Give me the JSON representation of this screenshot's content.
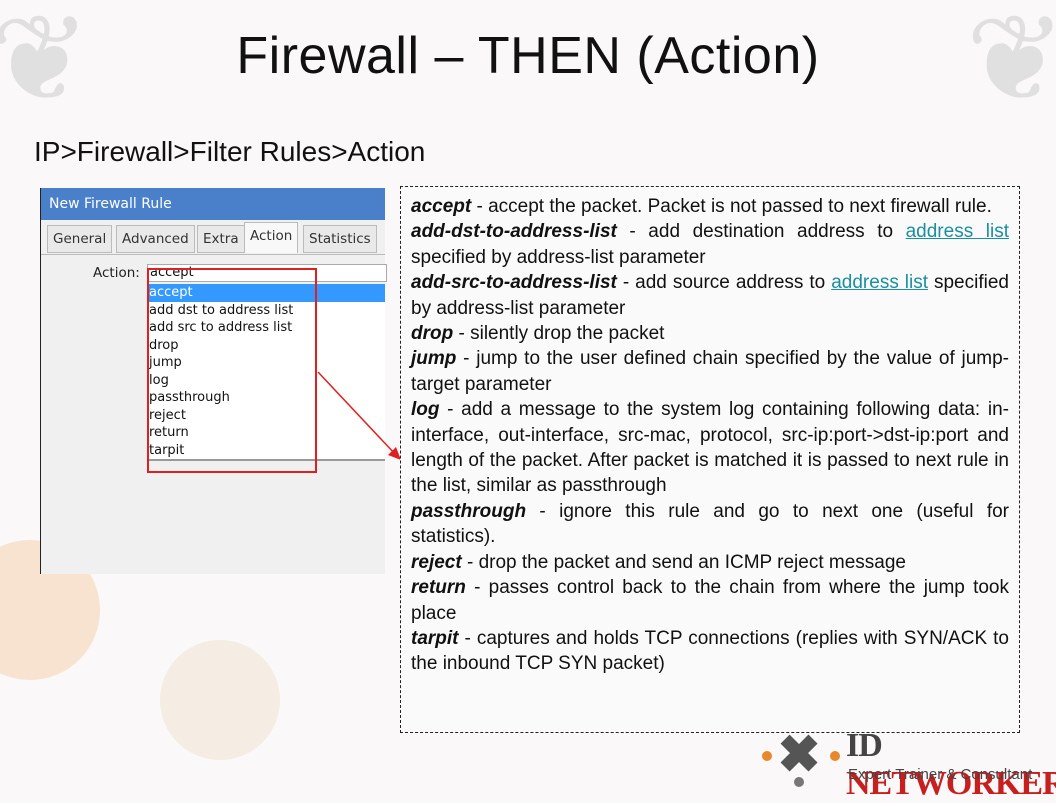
{
  "slide": {
    "title": "Firewall – THEN (Action)",
    "subtitle": "IP>Firewall>Filter Rules>Action"
  },
  "window": {
    "title": "New Firewall Rule",
    "tabs": [
      "General",
      "Advanced",
      "Extra",
      "Action",
      "Statistics"
    ],
    "active_tab": "Action",
    "action_label": "Action:",
    "action_value": "accept",
    "options": [
      "accept",
      "add dst to address list",
      "add src to address list",
      "drop",
      "jump",
      "log",
      "passthrough",
      "reject",
      "return",
      "tarpit"
    ],
    "selected_option": "accept"
  },
  "descriptions": [
    {
      "name": "accept",
      "text": " - accept the packet. Packet is not passed to next firewall rule."
    },
    {
      "name": "add-dst-to-address-list",
      "pre": " - add destination address to ",
      "link": "address list",
      "post": " specified by address-list parameter"
    },
    {
      "name": "add-src-to-address-list",
      "pre": " - add source address to ",
      "link": "address list",
      "post": " specified by address-list parameter"
    },
    {
      "name": "drop",
      "text": " - silently drop the packet"
    },
    {
      "name": "jump",
      "text": " - jump to the user defined chain specified by the value of jump-target parameter"
    },
    {
      "name": "log",
      "text": " - add a message to the system log containing following data: in-interface, out-interface, src-mac, protocol, src-ip:port->dst-ip:port and length of the packet. After packet is matched it is passed to next rule in the list, similar as passthrough"
    },
    {
      "name": "passthrough",
      "text": " - ignore this rule and go to next one (useful for statistics)."
    },
    {
      "name": "reject",
      "text": " - drop the packet and send an ICMP reject message"
    },
    {
      "name": "return",
      "text": " - passes control back to the chain from where the jump took place"
    },
    {
      "name": "tarpit",
      "text": " - captures and holds TCP connections (replies with SYN/ACK to the inbound TCP SYN packet)"
    }
  ],
  "logo": {
    "name_id": "ID",
    "name_rest": "NETWORKERS",
    "tagline": "Expert Trainer & Consultant"
  },
  "colors": {
    "titlebar": "#4a7fc9",
    "selection": "#3399ff",
    "highlight_box": "#e02020",
    "link": "#1a8fa0",
    "logo_red": "#c81e1e",
    "logo_orange": "#e8872b"
  }
}
